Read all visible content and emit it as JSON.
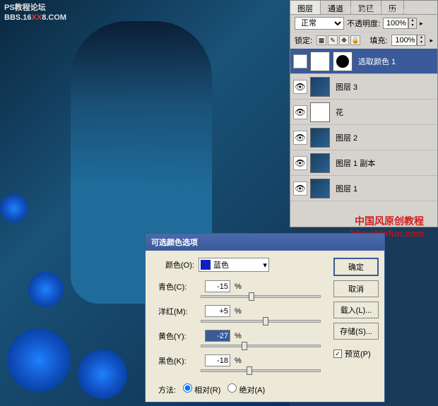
{
  "watermarks": {
    "top_left_line1": "PS教程论坛",
    "top_left_line2a": "BBS.16",
    "top_left_line2b": "XX",
    "top_left_line2c": "8.COM",
    "top_right": "网页教学网 www.webjx.com",
    "mid_right_line1": "中国风原创教程",
    "mid_right_line2": "bbs.chinfun.com"
  },
  "layers_panel": {
    "tabs": [
      "图层",
      "通道",
      "路径",
      "历"
    ],
    "blend_mode": "正常",
    "opacity_label": "不透明度:",
    "opacity_value": "100%",
    "lock_label": "锁定:",
    "fill_label": "填充:",
    "fill_value": "100%",
    "layers": [
      {
        "name": "选取颜色 1",
        "selected": true,
        "type": "adjustment"
      },
      {
        "name": "图层 3",
        "selected": false,
        "type": "image"
      },
      {
        "name": "花",
        "selected": false,
        "type": "flower"
      },
      {
        "name": "图层 2",
        "selected": false,
        "type": "image"
      },
      {
        "name": "图层 1 副本",
        "selected": false,
        "type": "image"
      },
      {
        "name": "图层 1",
        "selected": false,
        "type": "image"
      }
    ]
  },
  "dialog": {
    "title": "可选颜色选项",
    "color_label": "颜色(O):",
    "color_value": "蓝色",
    "sliders": [
      {
        "label": "青色(C):",
        "value": "-15",
        "pos": 40
      },
      {
        "label": "洋红(M):",
        "value": "+5",
        "pos": 52
      },
      {
        "label": "黄色(Y):",
        "value": "-27",
        "pos": 34,
        "focus": true
      },
      {
        "label": "黑色(K):",
        "value": "-18",
        "pos": 38
      }
    ],
    "method_label": "方法:",
    "method_relative": "相对(R)",
    "method_absolute": "绝对(A)",
    "buttons": {
      "ok": "确定",
      "cancel": "取消",
      "load": "载入(L)...",
      "save": "存储(S)..."
    },
    "preview_label": "预览(P)"
  }
}
